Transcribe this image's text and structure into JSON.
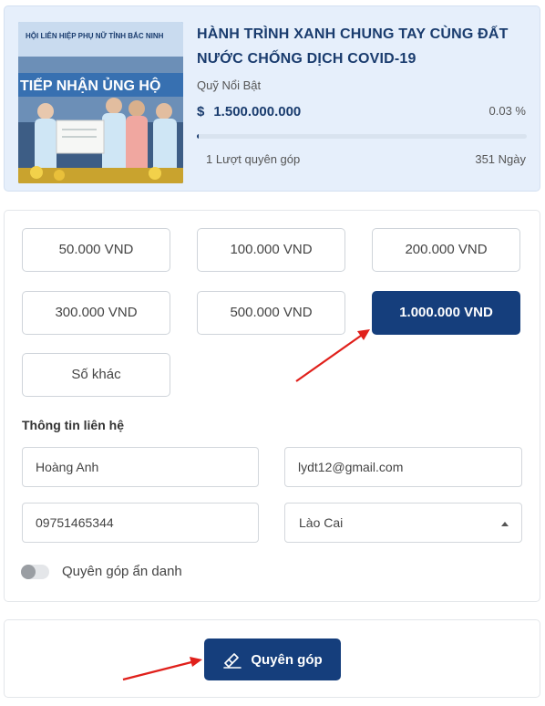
{
  "campaign": {
    "photo_banner_text": "HỘI LIÊN HIỆP PHỤ NỮ TỈNH BẮC NINH",
    "photo_slogan": "TIẾP NHẬN ỦNG HỘ",
    "title": "HÀNH TRÌNH XANH CHUNG TAY CÙNG ĐẤT NƯỚC CHỐNG DỊCH COVID-19",
    "organization": "Quỹ Nổi Bật",
    "currency_symbol": "$",
    "amount_raised": "1.500.000.000",
    "percent_label": "0.03 %",
    "progress_percent": 0.03,
    "donors_label": "1 Lượt quyên góp",
    "days_label": "351 Ngày"
  },
  "amounts": {
    "a50k": "50.000 VND",
    "a100k": "100.000 VND",
    "a200k": "200.000 VND",
    "a300k": "300.000 VND",
    "a500k": "500.000 VND",
    "a1m": "1.000.000 VND",
    "other": "Số khác",
    "selected": "1.000.000 VND"
  },
  "contact": {
    "section_title": "Thông tin liên hệ",
    "name_value": "Hoàng Anh",
    "email_value": "lydt12@gmail.com",
    "phone_value": "09751465344",
    "province_value": "Lào Cai"
  },
  "anonymous": {
    "label": "Quyên góp ẩn danh",
    "enabled": false
  },
  "submit": {
    "label": "Quyên góp"
  },
  "colors": {
    "primary": "#153e7c",
    "card_bg": "#e6effb",
    "annotation_arrow": "#e0201b"
  },
  "icons": {
    "donate_button_icon": "hand-heart-icon"
  }
}
